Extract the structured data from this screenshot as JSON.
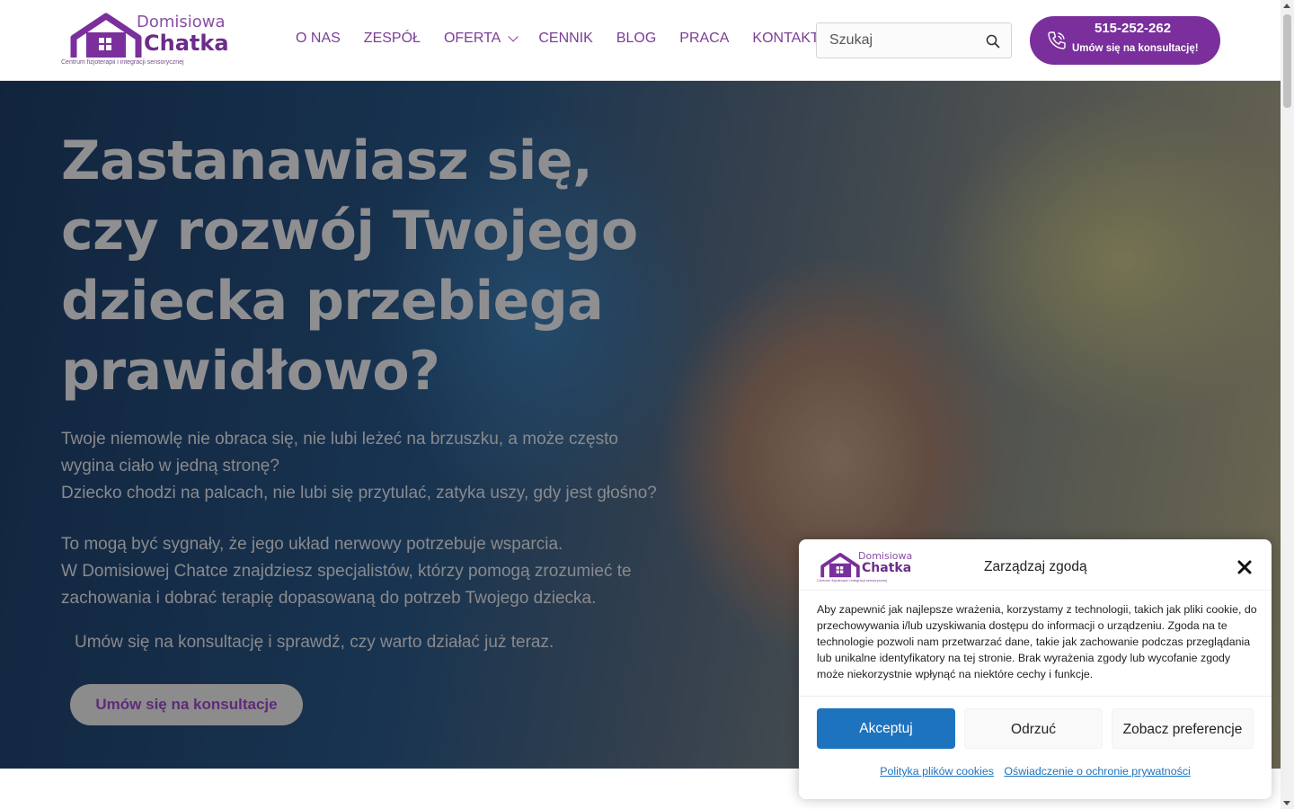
{
  "header": {
    "logo": {
      "top": "Domisiowa",
      "main": "Chatka",
      "sub": "Centrum fizjoterapii i integracji sensorycznej"
    },
    "nav": [
      {
        "label": "O NAS"
      },
      {
        "label": "ZESPÓŁ"
      },
      {
        "label": "OFERTA",
        "has_dropdown": true
      },
      {
        "label": "CENNIK"
      },
      {
        "label": "BLOG"
      },
      {
        "label": "PRACA"
      },
      {
        "label": "KONTAKT"
      }
    ],
    "search": {
      "placeholder": "Szukaj",
      "value": ""
    },
    "phone": {
      "number": "515-252-262",
      "subtitle": "Umów się na konsultację!"
    }
  },
  "hero": {
    "title": "Zastanawiasz się, czy rozwój Twojego dziecka przebiega prawidłowo?",
    "paragraph1_line1": "Twoje niemowlę nie obraca się, nie lubi leżeć na brzuszku, a może często wygina ciało w jedną stronę?",
    "paragraph1_line2": "Dziecko chodzi na palcach, nie lubi się przytulać, zatyka uszy, gdy jest głośno?",
    "paragraph2_line1": "To mogą być sygnały, że jego układ nerwowy potrzebuje wsparcia.",
    "paragraph2_line2": "W Domisiowej Chatce znajdziesz specjalistów, którzy pomogą zrozumieć te zachowania i dobrać terapię dopasowaną do potrzeb Twojego dziecka.",
    "paragraph3": "Umów się na konsultację i sprawdź, czy warto działać już teraz.",
    "button": "Umów się na konsultacje"
  },
  "cookie": {
    "logo": {
      "top": "Domisiowa",
      "main": "Chatka",
      "sub": "Centrum fizjoterapii i integracji sensorycznej"
    },
    "title": "Zarządzaj zgodą",
    "body": "Aby zapewnić jak najlepsze wrażenia, korzystamy z technologii, takich jak pliki cookie, do przechowywania i/lub uzyskiwania dostępu do informacji o urządzeniu. Zgoda na te technologie pozwoli nam przetwarzać dane, takie jak zachowanie podczas przeglądania lub unikalne identyfikatory na tej stronie. Brak wyrażenia zgody lub wycofanie zgody może niekorzystnie wpłynąć na niektóre cechy i funkcje.",
    "accept": "Akceptuj",
    "deny": "Odrzuć",
    "preferences": "Zobacz preferencje",
    "link_cookies": "Polityka plików cookies",
    "link_privacy": "Oświadczenie o ochronie prywatności"
  },
  "colors": {
    "brand_purple": "#7a2f9c",
    "accept_blue": "#1e73be"
  }
}
